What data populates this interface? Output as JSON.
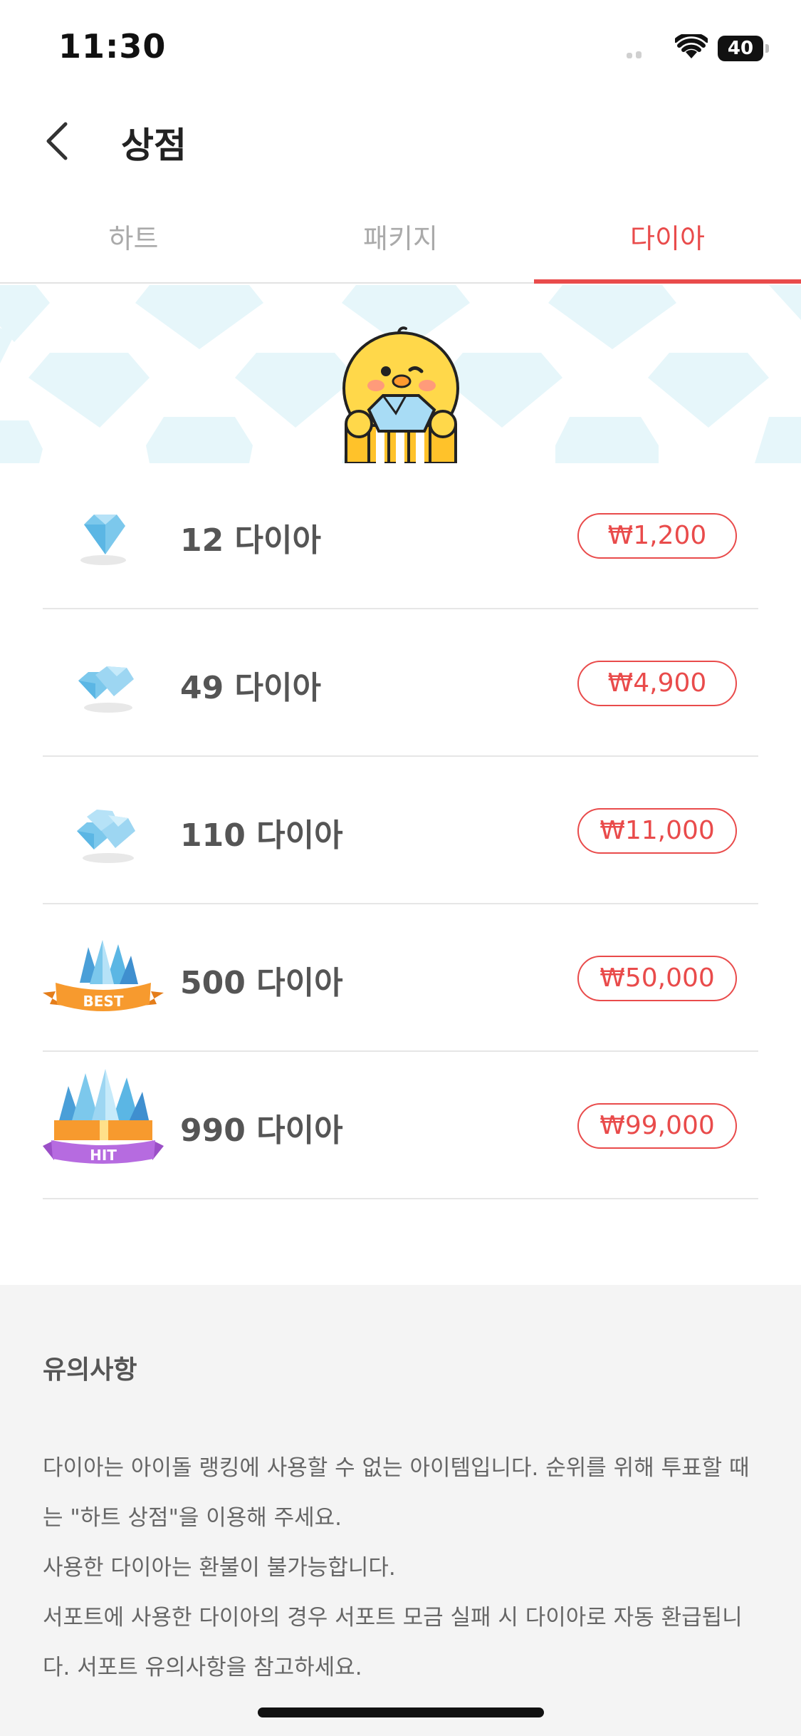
{
  "status": {
    "time": "11:30",
    "battery": "40"
  },
  "header": {
    "title": "상점"
  },
  "tabs": [
    {
      "label": "하트"
    },
    {
      "label": "패키지"
    },
    {
      "label": "다이아"
    }
  ],
  "products": [
    {
      "label": "12 다이아",
      "price": "₩1,200"
    },
    {
      "label": "49 다이아",
      "price": "₩4,900"
    },
    {
      "label": "110 다이아",
      "price": "₩11,000"
    },
    {
      "label": "500 다이아",
      "price": "₩50,000",
      "badge": "BEST"
    },
    {
      "label": "990 다이아",
      "price": "₩99,000",
      "badge": "HIT"
    }
  ],
  "notice": {
    "title": "유의사항",
    "lines": [
      "다이아는 아이돌 랭킹에 사용할 수 없는 아이템입니다. 순위를 위해 투표할 때는 \"하트 상점\"을 이용해 주세요.",
      "사용한 다이아는 환불이 불가능합니다.",
      "서포트에 사용한 다이아의 경우 서포트 모금 실패 시 다이아로 자동 환급됩니다. 서포트 유의사항을 참고하세요."
    ]
  },
  "colors": {
    "accent": "#e94b4b",
    "pattern": "#e4f5f8",
    "gem": "#7cc8ec"
  }
}
